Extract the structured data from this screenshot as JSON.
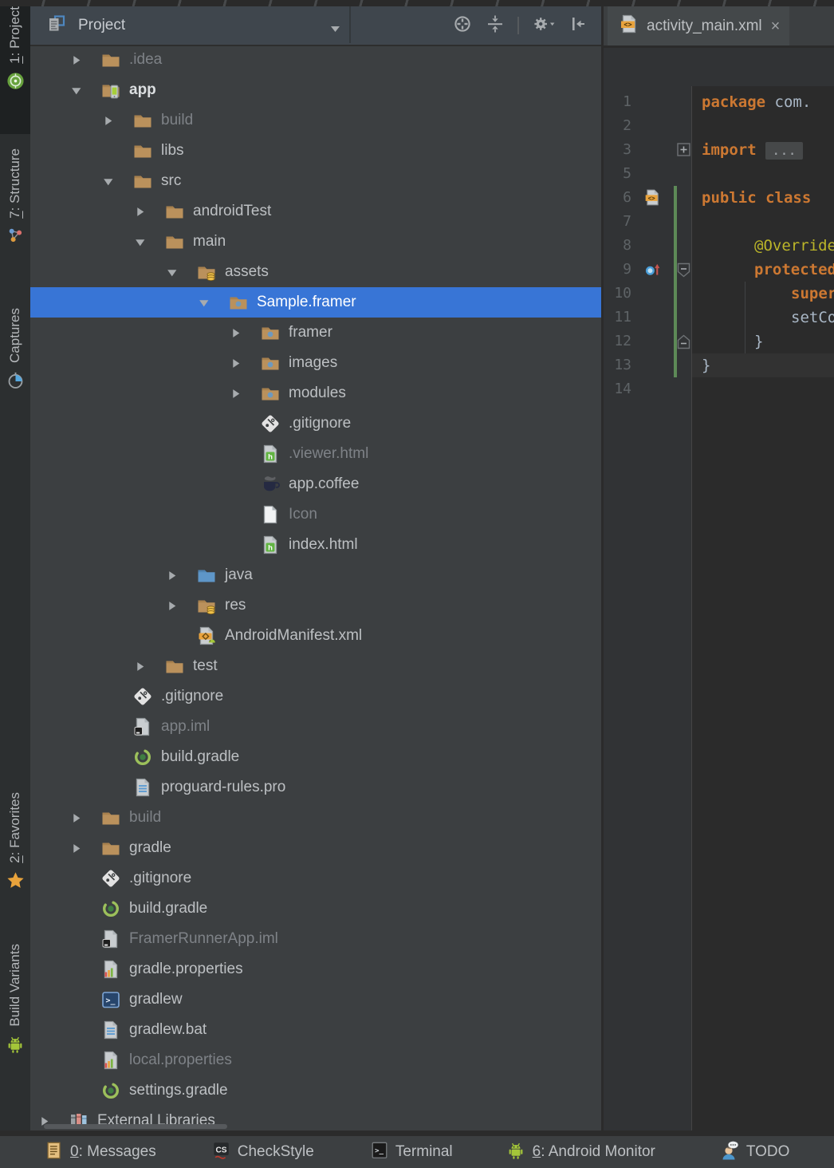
{
  "stripe": {
    "top": [
      {
        "label": "1: Project",
        "mnemonic": "1",
        "icon": "android-studio",
        "active": true
      },
      {
        "label": "7: Structure",
        "mnemonic": "7",
        "icon": "structure",
        "active": false
      },
      {
        "label": "Captures",
        "mnemonic": "",
        "icon": "captures",
        "active": false
      }
    ],
    "bottom": [
      {
        "label": "2: Favorites",
        "mnemonic": "2",
        "icon": "star",
        "active": false
      },
      {
        "label": "Build Variants",
        "mnemonic": "",
        "icon": "android",
        "active": false
      }
    ]
  },
  "project_panel": {
    "title": "Project",
    "toolbar": [
      {
        "icon": "locate"
      },
      {
        "icon": "collapse-all"
      },
      {
        "icon": "separator"
      },
      {
        "icon": "gear"
      },
      {
        "icon": "hide"
      }
    ],
    "tree": [
      {
        "label": ".idea",
        "level": 1,
        "arrow": "collapsed",
        "icon": "folder",
        "dim": true
      },
      {
        "label": "app",
        "level": 1,
        "arrow": "expanded",
        "icon": "android-module",
        "bold": true
      },
      {
        "label": "build",
        "level": 2,
        "arrow": "collapsed",
        "icon": "folder",
        "dim": true
      },
      {
        "label": "libs",
        "level": 2,
        "arrow": "none",
        "icon": "folder"
      },
      {
        "label": "src",
        "level": 2,
        "arrow": "expanded",
        "icon": "folder"
      },
      {
        "label": "androidTest",
        "level": 3,
        "arrow": "collapsed",
        "icon": "folder"
      },
      {
        "label": "main",
        "level": 3,
        "arrow": "expanded",
        "icon": "folder"
      },
      {
        "label": "assets",
        "level": 4,
        "arrow": "expanded",
        "icon": "folder-res"
      },
      {
        "label": "Sample.framer",
        "level": 5,
        "arrow": "expanded",
        "icon": "folder-dot",
        "selected": true
      },
      {
        "label": "framer",
        "level": 6,
        "arrow": "collapsed",
        "icon": "folder-dot"
      },
      {
        "label": "images",
        "level": 6,
        "arrow": "collapsed",
        "icon": "folder-dot"
      },
      {
        "label": "modules",
        "level": 6,
        "arrow": "collapsed",
        "icon": "folder-dot"
      },
      {
        "label": ".gitignore",
        "level": 6,
        "arrow": "none",
        "icon": "git"
      },
      {
        "label": ".viewer.html",
        "level": 6,
        "arrow": "none",
        "icon": "html",
        "dim": true
      },
      {
        "label": "app.coffee",
        "level": 6,
        "arrow": "none",
        "icon": "coffee"
      },
      {
        "label": "Icon",
        "level": 6,
        "arrow": "none",
        "icon": "file-plain",
        "dim": true
      },
      {
        "label": "index.html",
        "level": 6,
        "arrow": "none",
        "icon": "html"
      },
      {
        "label": "java",
        "level": 4,
        "arrow": "collapsed",
        "icon": "folder-java"
      },
      {
        "label": "res",
        "level": 4,
        "arrow": "collapsed",
        "icon": "folder-res"
      },
      {
        "label": "AndroidManifest.xml",
        "level": 4,
        "arrow": "none",
        "icon": "manifest"
      },
      {
        "label": "test",
        "level": 3,
        "arrow": "collapsed",
        "icon": "folder"
      },
      {
        "label": ".gitignore",
        "level": 2,
        "arrow": "none",
        "icon": "git"
      },
      {
        "label": "app.iml",
        "level": 2,
        "arrow": "none",
        "icon": "iml",
        "dim": true
      },
      {
        "label": "build.gradle",
        "level": 2,
        "arrow": "none",
        "icon": "gradle"
      },
      {
        "label": "proguard-rules.pro",
        "level": 2,
        "arrow": "none",
        "icon": "text-file"
      },
      {
        "label": "build",
        "level": 1,
        "arrow": "collapsed",
        "icon": "folder",
        "dim": true
      },
      {
        "label": "gradle",
        "level": 1,
        "arrow": "collapsed",
        "icon": "folder"
      },
      {
        "label": ".gitignore",
        "level": 1,
        "arrow": "none",
        "icon": "git"
      },
      {
        "label": "build.gradle",
        "level": 1,
        "arrow": "none",
        "icon": "gradle"
      },
      {
        "label": "FramerRunnerApp.iml",
        "level": 1,
        "arrow": "none",
        "icon": "iml",
        "dim": true
      },
      {
        "label": "gradle.properties",
        "level": 1,
        "arrow": "none",
        "icon": "properties"
      },
      {
        "label": "gradlew",
        "level": 1,
        "arrow": "none",
        "icon": "terminal-file"
      },
      {
        "label": "gradlew.bat",
        "level": 1,
        "arrow": "none",
        "icon": "text-file"
      },
      {
        "label": "local.properties",
        "level": 1,
        "arrow": "none",
        "icon": "properties",
        "dim": true
      },
      {
        "label": "settings.gradle",
        "level": 1,
        "arrow": "none",
        "icon": "gradle"
      },
      {
        "label": "External Libraries",
        "level": 0,
        "arrow": "collapsed",
        "icon": "libraries"
      }
    ]
  },
  "editor": {
    "tab": {
      "label": "activity_main.xml",
      "icon": "xml-file",
      "close_glyph": "×"
    },
    "lines": [
      {
        "num": "1",
        "indent": 0,
        "code": [
          {
            "t": "package ",
            "c": "kw"
          },
          {
            "t": "com.",
            "c": "pl"
          }
        ]
      },
      {
        "num": "2",
        "indent": 0,
        "code": []
      },
      {
        "num": "3",
        "indent": 0,
        "fold": "plus",
        "code": [
          {
            "t": "import ",
            "c": "kw"
          },
          {
            "t": "...",
            "c": "folded"
          }
        ]
      },
      {
        "num": "5",
        "indent": 0,
        "code": []
      },
      {
        "num": "6",
        "indent": 0,
        "gicon": "xml-file",
        "code": [
          {
            "t": "public class",
            "c": "kw"
          }
        ]
      },
      {
        "num": "7",
        "indent": 0,
        "code": []
      },
      {
        "num": "8",
        "indent": 1,
        "code": [
          {
            "t": "@Override",
            "c": "ann"
          }
        ]
      },
      {
        "num": "9",
        "indent": 1,
        "gicon": "override",
        "fold": "top",
        "code": [
          {
            "t": "protected",
            "c": "kw"
          }
        ]
      },
      {
        "num": "10",
        "indent": 2,
        "code": [
          {
            "t": "super",
            "c": "kw"
          }
        ]
      },
      {
        "num": "11",
        "indent": 2,
        "code": [
          {
            "t": "setContentView",
            "c": "pl"
          }
        ]
      },
      {
        "num": "12",
        "indent": 1,
        "fold": "bottom",
        "code": [
          {
            "t": "}",
            "c": "pl"
          }
        ]
      },
      {
        "num": "13",
        "indent": 0,
        "current": true,
        "code": [
          {
            "t": "}",
            "c": "pl"
          }
        ]
      },
      {
        "num": "14",
        "indent": 0,
        "code": []
      }
    ]
  },
  "status_bar": [
    {
      "label": "0: Messages",
      "mnemonic": "0",
      "icon": "messages"
    },
    {
      "label": "CheckStyle",
      "mnemonic": "",
      "icon": "checkstyle"
    },
    {
      "label": "Terminal",
      "mnemonic": "",
      "icon": "terminal"
    },
    {
      "label": "6: Android Monitor",
      "mnemonic": "6",
      "icon": "android"
    },
    {
      "label": "TODO",
      "mnemonic": "",
      "icon": "todo"
    }
  ]
}
